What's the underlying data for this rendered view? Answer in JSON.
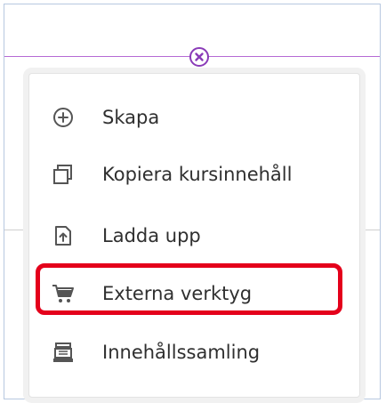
{
  "menu": {
    "items": [
      {
        "label": "Skapa",
        "icon": "plus-circle-icon"
      },
      {
        "label": "Kopiera kursinnehåll",
        "icon": "copy-icon"
      },
      {
        "label": "Ladda upp",
        "icon": "upload-file-icon"
      },
      {
        "label": "Externa verktyg",
        "icon": "cart-icon",
        "highlighted": true
      },
      {
        "label": "Innehållssamling",
        "icon": "archive-icon"
      }
    ]
  },
  "colors": {
    "accent": "#8a3bb8",
    "divider": "#b56ad4",
    "highlight": "#e4001b",
    "text": "#2f2f2f",
    "icon": "#555555"
  }
}
